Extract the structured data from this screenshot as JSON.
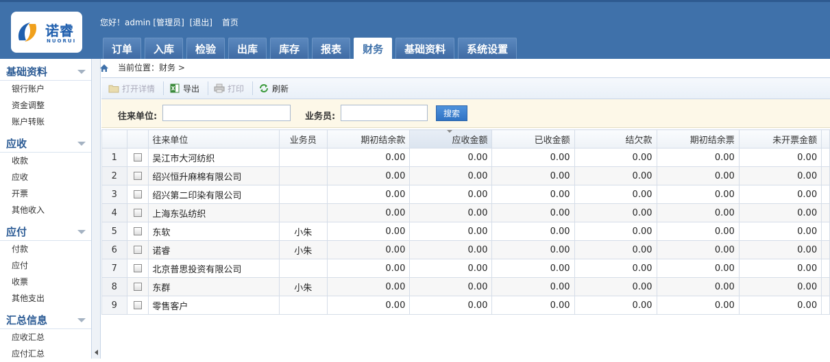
{
  "logo": {
    "name": "诺睿",
    "sub": "NUORUI"
  },
  "userbar": {
    "greeting": "您好！admin [管理员]",
    "logout": "[退出]",
    "home": "首页"
  },
  "nav": [
    {
      "label": "订单",
      "active": false
    },
    {
      "label": "入库",
      "active": false
    },
    {
      "label": "检验",
      "active": false
    },
    {
      "label": "出库",
      "active": false
    },
    {
      "label": "库存",
      "active": false
    },
    {
      "label": "报表",
      "active": false
    },
    {
      "label": "财务",
      "active": true
    },
    {
      "label": "基础资料",
      "active": false
    },
    {
      "label": "系统设置",
      "active": false
    }
  ],
  "sidebar": [
    {
      "title": "基础资料",
      "items": [
        "银行账户",
        "资金调整",
        "账户转账"
      ]
    },
    {
      "title": "应收",
      "items": [
        "收款",
        "应收",
        "开票",
        "其他收入"
      ]
    },
    {
      "title": "应付",
      "items": [
        "付款",
        "应付",
        "收票",
        "其他支出"
      ]
    },
    {
      "title": "汇总信息",
      "items": [
        "应收汇总",
        "应付汇总"
      ]
    }
  ],
  "breadcrumb": "当前位置：财务 >",
  "toolbar": {
    "open": "打开详情",
    "export": "导出",
    "print": "打印",
    "refresh": "刷新"
  },
  "filter": {
    "partner_label": "往来单位:",
    "partner_value": "",
    "staff_label": "业务员:",
    "staff_value": "",
    "search": "搜索"
  },
  "table": {
    "headers": [
      "往来单位",
      "业务员",
      "期初结余款",
      "应收金额",
      "已收金额",
      "结欠款",
      "期初结余票",
      "未开票金额"
    ],
    "rows": [
      {
        "no": "1",
        "unit": "吴江市大河纺织",
        "staff": "",
        "v": [
          "0.00",
          "0.00",
          "0.00",
          "0.00",
          "0.00",
          "0.00"
        ]
      },
      {
        "no": "2",
        "unit": "绍兴恒升麻棉有限公司",
        "staff": "",
        "v": [
          "0.00",
          "0.00",
          "0.00",
          "0.00",
          "0.00",
          "0.00"
        ]
      },
      {
        "no": "3",
        "unit": "绍兴第二印染有限公司",
        "staff": "",
        "v": [
          "0.00",
          "0.00",
          "0.00",
          "0.00",
          "0.00",
          "0.00"
        ]
      },
      {
        "no": "4",
        "unit": "上海东弘纺织",
        "staff": "",
        "v": [
          "0.00",
          "0.00",
          "0.00",
          "0.00",
          "0.00",
          "0.00"
        ]
      },
      {
        "no": "5",
        "unit": "东软",
        "staff": "小朱",
        "v": [
          "0.00",
          "0.00",
          "0.00",
          "0.00",
          "0.00",
          "0.00"
        ]
      },
      {
        "no": "6",
        "unit": "诺睿",
        "staff": "小朱",
        "v": [
          "0.00",
          "0.00",
          "0.00",
          "0.00",
          "0.00",
          "0.00"
        ]
      },
      {
        "no": "7",
        "unit": "北京普思投资有限公司",
        "staff": "",
        "v": [
          "0.00",
          "0.00",
          "0.00",
          "0.00",
          "0.00",
          "0.00"
        ]
      },
      {
        "no": "8",
        "unit": "东群",
        "staff": "小朱",
        "v": [
          "0.00",
          "0.00",
          "0.00",
          "0.00",
          "0.00",
          "0.00"
        ]
      },
      {
        "no": "9",
        "unit": "零售客户",
        "staff": "",
        "v": [
          "0.00",
          "0.00",
          "0.00",
          "0.00",
          "0.00",
          "0.00"
        ]
      }
    ]
  }
}
